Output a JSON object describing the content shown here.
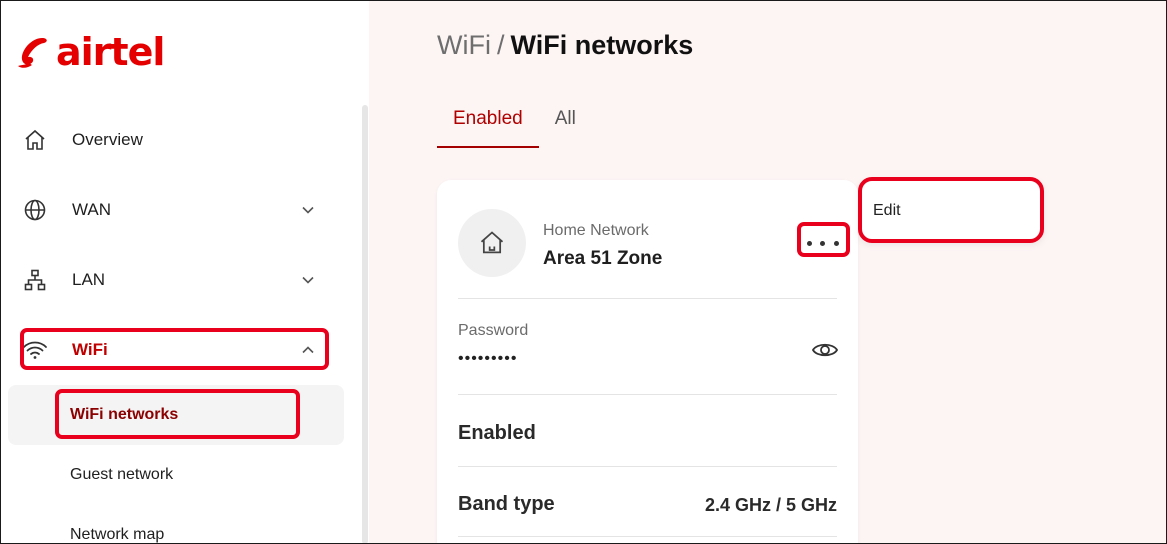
{
  "brand": {
    "name": "airtel",
    "color": "#e40000"
  },
  "sidebar": {
    "items": [
      {
        "label": "Overview",
        "icon": "home-icon"
      },
      {
        "label": "WAN",
        "icon": "globe-icon",
        "expandable": true
      },
      {
        "label": "LAN",
        "icon": "network-tree-icon",
        "expandable": true
      },
      {
        "label": "WiFi",
        "icon": "wifi-icon",
        "expanded": true
      }
    ],
    "wifi_subitems": [
      {
        "label": "WiFi networks",
        "selected": true
      },
      {
        "label": "Guest network"
      },
      {
        "label": "Network map"
      }
    ]
  },
  "header": {
    "breadcrumb_parent": "WiFi",
    "breadcrumb_separator": "/",
    "breadcrumb_current": "WiFi networks"
  },
  "tabs": [
    {
      "label": "Enabled",
      "active": true
    },
    {
      "label": "All"
    }
  ],
  "network_card": {
    "network_label": "Home Network",
    "network_name": "Area 51 Zone",
    "password_label": "Password",
    "password_value": "•••••••••",
    "status_label": "Enabled",
    "band_label": "Band type",
    "band_value": "2.4 GHz / 5 GHz"
  },
  "more_menu": {
    "items": [
      {
        "label": "Edit"
      }
    ]
  },
  "highlight_color": "#e8001c"
}
